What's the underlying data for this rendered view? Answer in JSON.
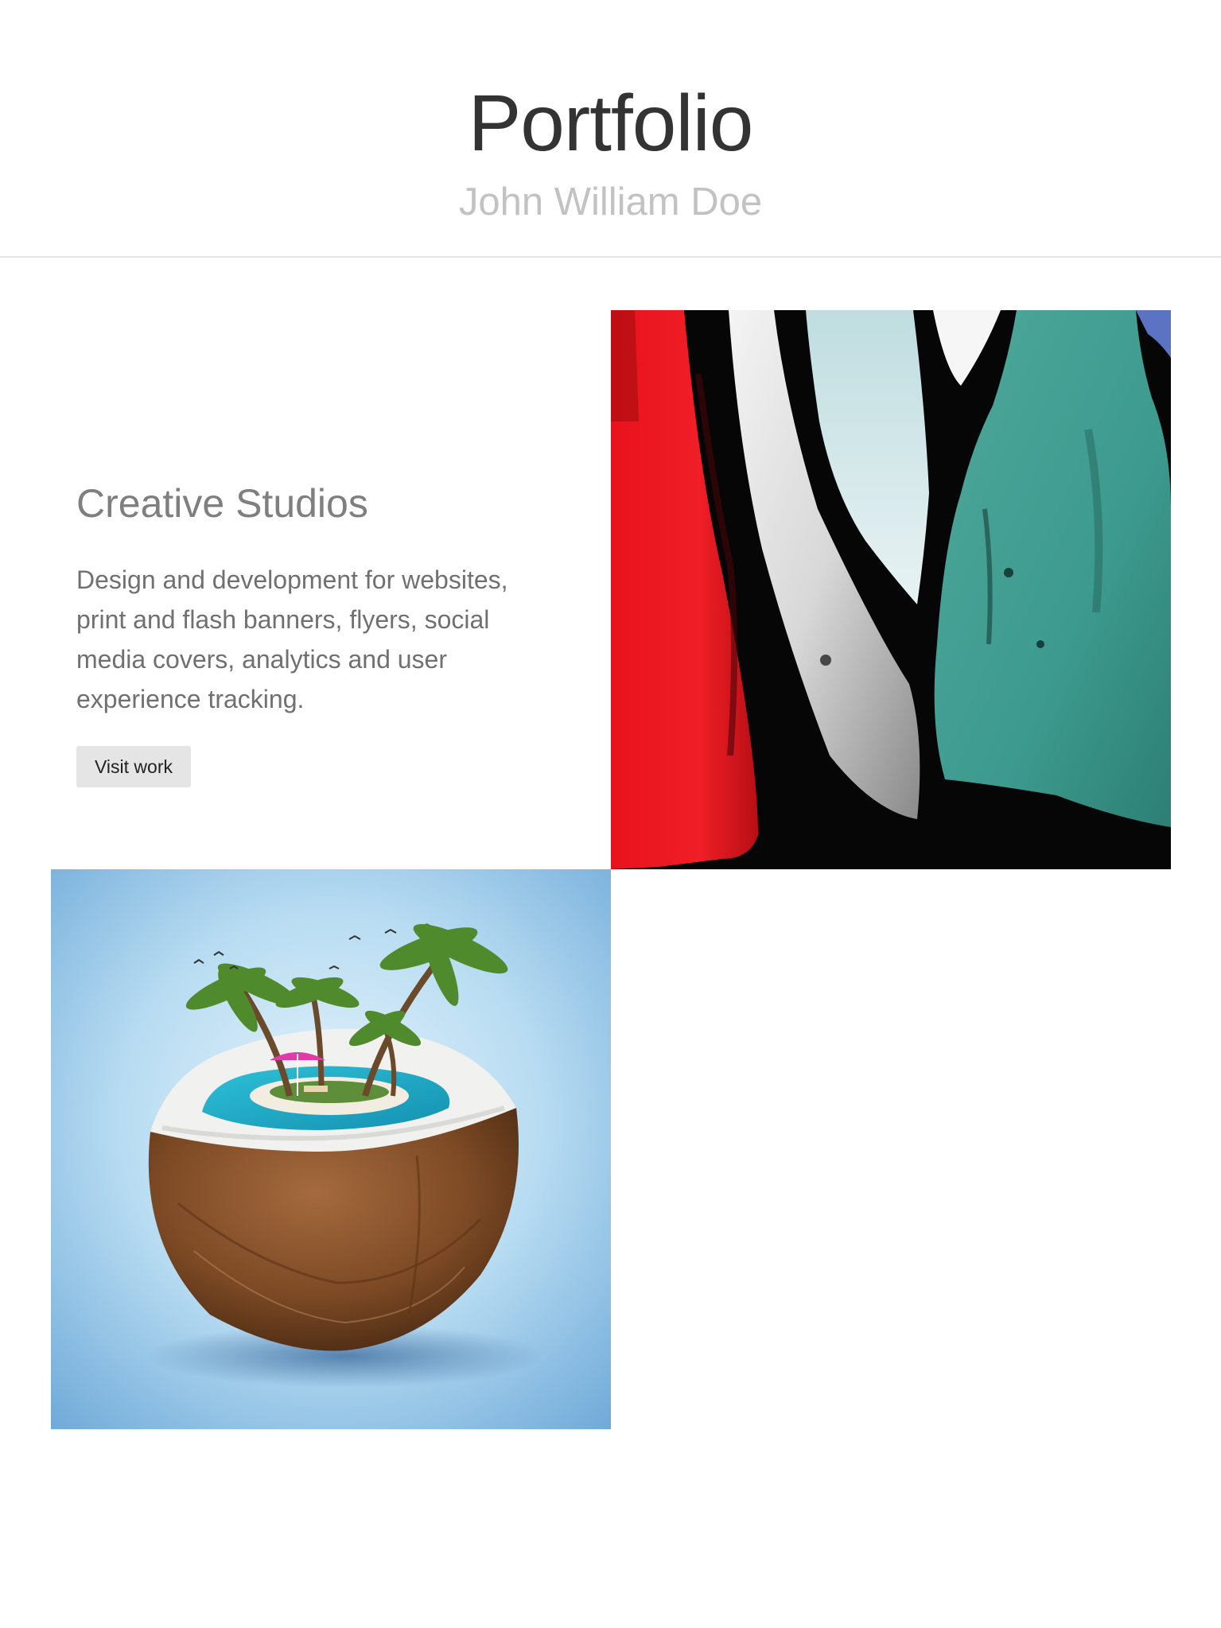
{
  "header": {
    "title": "Portfolio",
    "subtitle": "John William Doe"
  },
  "project": {
    "title": "Creative Studios",
    "description": "Design and development for websites, print and flash banners, flyers, social media covers, analytics and user experience tracking.",
    "button_label": "Visit work"
  },
  "colors": {
    "title_text": "#333333",
    "subtitle_text": "#c2c2c2",
    "body_text": "#707070",
    "button_bg": "#e5e5e5",
    "divider": "#e6e6e6"
  },
  "images": [
    {
      "name": "abstract-painting-image",
      "description_icon": "image-icon"
    },
    {
      "name": "coconut-island-image",
      "description_icon": "image-icon"
    }
  ]
}
